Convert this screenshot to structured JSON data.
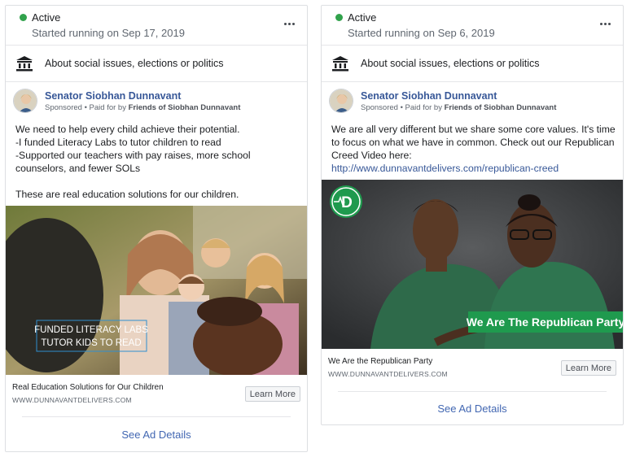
{
  "cards": [
    {
      "status": "Active",
      "started": "Started running on Sep 17, 2019",
      "category": "About social issues, elections or politics",
      "page_name": "Senator Siobhan Dunnavant",
      "sponsored_prefix": "Sponsored • Paid for by ",
      "funder": "Friends of Siobhan Dunnavant",
      "body": "We need to help every child achieve their potential.\n-I funded Literacy Labs to tutor children to read\n-Supported our teachers with pay raises, more school counselors, and fewer SOLs\n\nThese are real education solutions for our children.",
      "creative_caption_line1": "FUNDED LITERACY LABS",
      "creative_caption_line2": "TUTOR KIDS TO READ",
      "headline": "Real Education Solutions for Our Children",
      "domain": "WWW.DUNNAVANTDELIVERS.COM",
      "cta": "Learn More",
      "details_link": "See Ad Details"
    },
    {
      "status": "Active",
      "started": "Started running on Sep 6, 2019",
      "category": "About social issues, elections or politics",
      "page_name": "Senator Siobhan Dunnavant",
      "sponsored_prefix": "Sponsored • Paid for by ",
      "funder": "Friends of Siobhan Dunnavant",
      "body": "We are all very different but we share some core values. It's time to focus on what we have in common. Check out our Republican Creed Video here: ",
      "body_link": "http://www.dunnavantdelivers.com/republican-creed",
      "creative_logo": "D",
      "creative_banner": "We Are The Republican Party",
      "headline": "We Are the Republican Party",
      "domain": "WWW.DUNNAVANTDELIVERS.COM",
      "cta": "Learn More",
      "details_link": "See Ad Details"
    }
  ],
  "colors": {
    "active_dot": "#31a24c",
    "link": "#385898",
    "details_link": "#4267b2",
    "banner_green": "#1f9a4e"
  },
  "icons": {
    "more": "more-options-icon",
    "category": "government-building-icon"
  }
}
